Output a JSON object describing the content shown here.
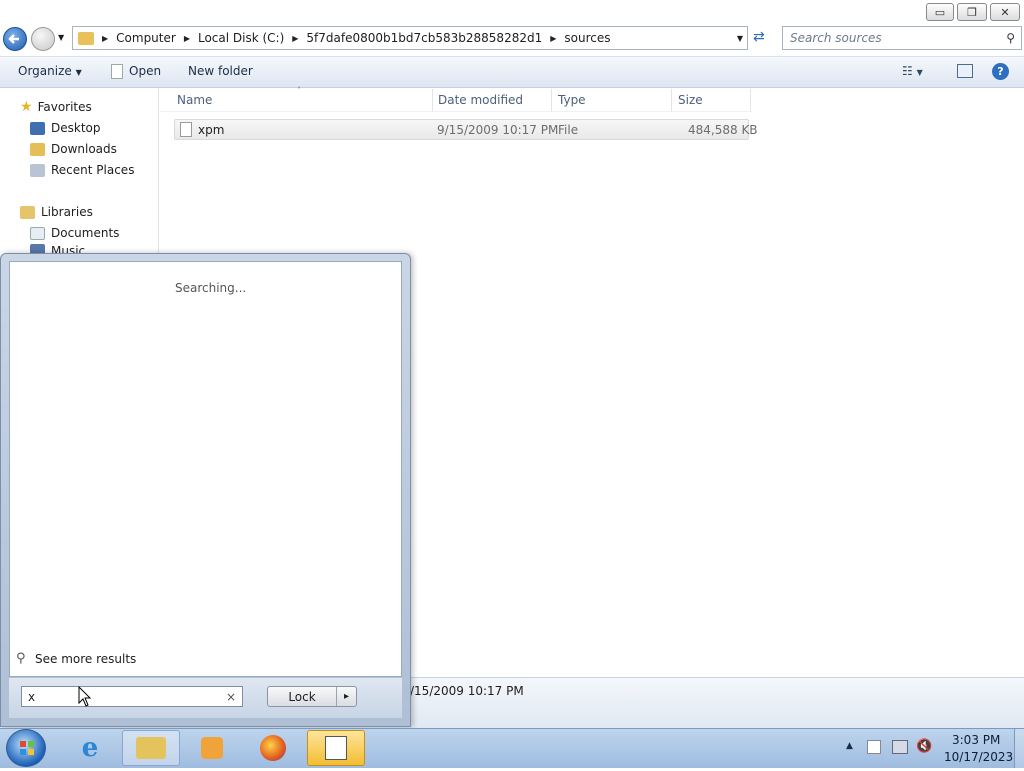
{
  "window": {
    "controls": {
      "minimize": "▭",
      "maximize": "❐",
      "close": "✕"
    }
  },
  "address": {
    "crumbs": [
      "Computer",
      "Local Disk (C:)",
      "5f7dafe0800b1bd7cb583b28858282d1",
      "sources"
    ]
  },
  "search": {
    "placeholder": "Search sources"
  },
  "toolbar": {
    "organize": "Organize",
    "open": "Open",
    "new_folder": "New folder"
  },
  "nav": {
    "favorites": "Favorites",
    "items": [
      "Desktop",
      "Downloads",
      "Recent Places"
    ],
    "libraries": "Libraries",
    "lib_items": [
      "Documents",
      "Music"
    ]
  },
  "columns": {
    "name": "Name",
    "date": "Date modified",
    "type": "Type",
    "size": "Size"
  },
  "files": [
    {
      "name": "xpm",
      "date": "9/15/2009 10:17 PM",
      "type": "File",
      "size": "484,588 KB"
    }
  ],
  "details": {
    "date_fragment": "/15/2009 10:17 PM"
  },
  "startmenu": {
    "status": "Searching...",
    "see_more": "See more results",
    "query": "x",
    "clear": "×",
    "lock_label": "Lock",
    "arrow": "▸"
  },
  "taskbar": {
    "time": "3:03 PM",
    "date": "10/17/2023"
  },
  "colors": {
    "accent": "#1d5bb0",
    "taskbar": "#a9c4e6",
    "active_app": "#f6c94b"
  }
}
